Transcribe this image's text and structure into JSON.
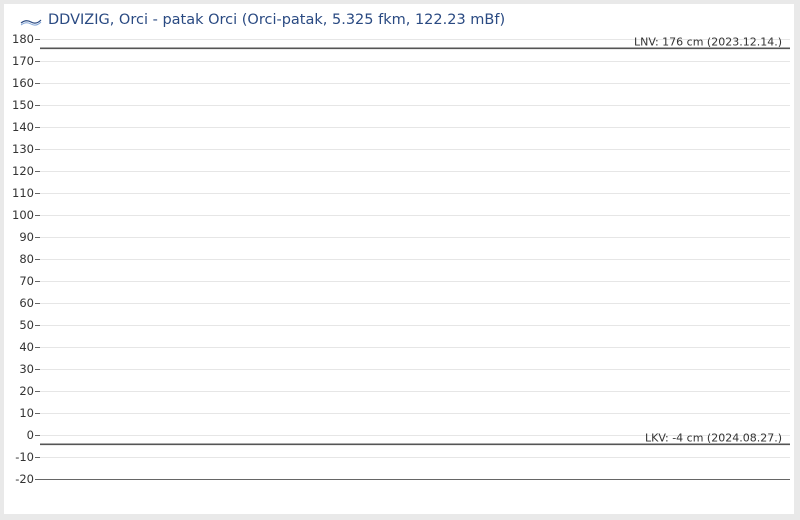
{
  "title": "DDVIZIG, Orci - patak Orci (Orci-patak, 5.325 fkm, 122.23 mBf)",
  "logo_text": "VIZIG",
  "chart_data": {
    "type": "line",
    "title": "DDVIZIG, Orci - patak Orci (Orci-patak, 5.325 fkm, 122.23 mBf)",
    "xlabel": "",
    "ylabel": "",
    "ylim": [
      -20,
      180
    ],
    "yticks": [
      -20,
      -10,
      0,
      10,
      20,
      30,
      40,
      50,
      60,
      70,
      80,
      90,
      100,
      110,
      120,
      130,
      140,
      150,
      160,
      170,
      180
    ],
    "grid": true,
    "series": [],
    "reference_lines": [
      {
        "label": "LNV: 176 cm (2023.12.14.)",
        "value": 176
      },
      {
        "label": "LKV: -4 cm (2024.08.27.)",
        "value": -4
      }
    ]
  },
  "colors": {
    "title": "#2a4a82",
    "grid": "#e6e6e6",
    "reference_line": "#555555",
    "axis_text": "#333333",
    "background": "#e9e9e9"
  }
}
